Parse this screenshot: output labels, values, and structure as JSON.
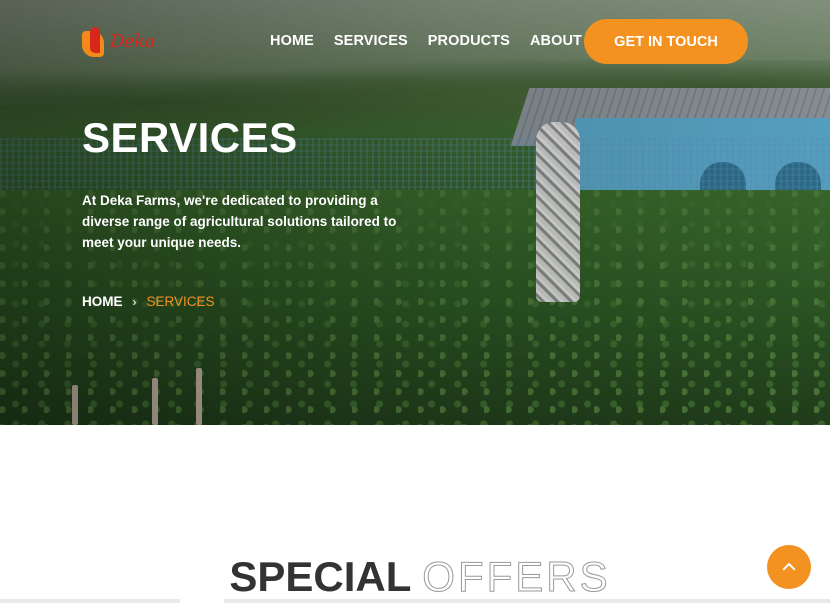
{
  "brand": {
    "logo_text": "Deka"
  },
  "nav": {
    "items": [
      {
        "label": "HOME"
      },
      {
        "label": "SERVICES"
      },
      {
        "label": "PRODUCTS"
      },
      {
        "label": "ABOUT"
      }
    ],
    "cta_label": "GET IN TOUCH"
  },
  "hero": {
    "title": "SERVICES",
    "description": "At Deka Farms, we're dedicated to providing a diverse range of agricultural solutions tailored to meet your unique needs.",
    "breadcrumb": {
      "home": "HOME",
      "separator": "›",
      "current": "SERVICES"
    }
  },
  "section": {
    "title_strong": "SPECIAL",
    "title_light": "OFFERS"
  },
  "icons": {
    "scroll_top": "chevron-up-icon",
    "breadcrumb_separator": "chevron-right-icon"
  },
  "colors": {
    "accent": "#f39221",
    "heading_dark": "#333333"
  }
}
